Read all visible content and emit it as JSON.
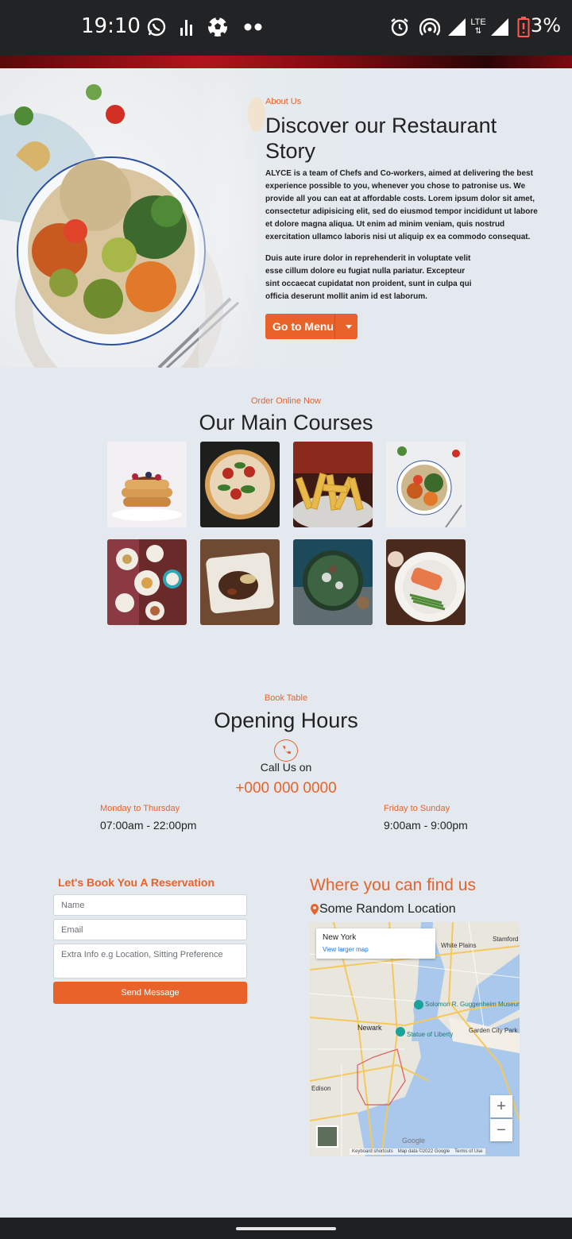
{
  "status_bar": {
    "time": "19:10",
    "battery": "3%",
    "network": "LTE"
  },
  "about": {
    "eyebrow": "About Us",
    "title": "Discover our Restaurant Story",
    "paragraph1": "ALYCE is a team of Chefs and Co-workers, aimed at delivering the best experience possible to you, whenever you chose to patronise us. We provide all you can eat at affordable costs. Lorem ipsum dolor sit amet, consectetur adipisicing elit, sed do eiusmod tempor incididunt ut labore et dolore magna aliqua. Ut enim ad minim veniam, quis nostrud exercitation ullamco laboris nisi ut aliquip ex ea commodo consequat.",
    "paragraph2": "Duis aute irure dolor in reprehenderit in voluptate velit esse cillum dolore eu fugiat nulla pariatur. Excepteur sint occaecat cupidatat non proident, sunt in culpa qui officia deserunt mollit anim id est laborum.",
    "menu_button": "Go to Menu"
  },
  "courses": {
    "eyebrow": "Order Online Now",
    "title": "Our Main Courses",
    "items": [
      "pancakes",
      "pizza",
      "fries",
      "salad-bowl",
      "tapas-spread",
      "steak-plate",
      "spinach-dish",
      "salmon-plate"
    ]
  },
  "hours": {
    "eyebrow": "Book Table",
    "title": "Opening Hours",
    "call_label": "Call Us on",
    "phone": "+000 000 0000",
    "weekday_label": "Monday to Thursday",
    "weekday_hours": "07:00am - 22:00pm",
    "weekend_label": "Friday to Sunday",
    "weekend_hours": "9:00am - 9:00pm"
  },
  "reservation": {
    "title": "Let's Book You A Reservation",
    "name_placeholder": "Name",
    "email_placeholder": "Email",
    "extra_placeholder": "Extra Info e.g Location, Sitting Preference",
    "send_button": "Send Message"
  },
  "location": {
    "title": "Where you can find us",
    "address": "Some Random Location",
    "map_card_title": "New York",
    "map_card_link": "View larger map",
    "map_labels": [
      "White Plains",
      "Stamford",
      "Newark",
      "Solomon R. Guggenheim Museum",
      "Statue of Liberty",
      "Garden City Park",
      "Edison",
      "Google"
    ],
    "zoom_in": "+",
    "zoom_out": "−",
    "footer_shortcuts": "Keyboard shortcuts",
    "footer_data": "Map data ©2022 Google",
    "footer_terms": "Terms of Use"
  }
}
